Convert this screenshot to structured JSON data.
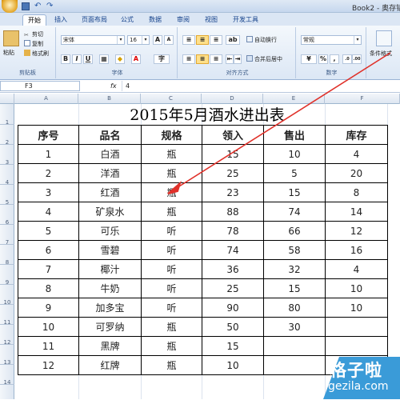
{
  "window": {
    "title": "Book2 - 奥存错"
  },
  "tabs": [
    "开始",
    "插入",
    "页面布局",
    "公式",
    "数据",
    "审阅",
    "视图",
    "开发工具"
  ],
  "ribbon": {
    "paste": "粘贴",
    "cut": "剪切",
    "copy": "复制",
    "format_painter": "格式刷",
    "clipboard_label": "剪贴板",
    "font_name": "宋体",
    "font_size": "16",
    "font_label": "字体",
    "wrap_text": "自动换行",
    "merge_center": "合并后居中",
    "align_label": "对齐方式",
    "number_format": "常规",
    "number_label": "数字",
    "cond_format": "条件格式"
  },
  "formula_bar": {
    "name_box": "F3",
    "fx": "fx",
    "value": "4"
  },
  "columns": [
    "A",
    "B",
    "C",
    "D",
    "E",
    "F"
  ],
  "rows": [
    "1",
    "2",
    "3",
    "4",
    "5",
    "6",
    "7",
    "8",
    "9",
    "10",
    "11",
    "12",
    "13",
    "14"
  ],
  "sheet": {
    "title": "2015年5月酒水进出表",
    "headers": [
      "序号",
      "品名",
      "规格",
      "领入",
      "售出",
      "库存"
    ],
    "data": [
      [
        "1",
        "白酒",
        "瓶",
        "15",
        "10",
        "4"
      ],
      [
        "2",
        "洋酒",
        "瓶",
        "25",
        "5",
        "20"
      ],
      [
        "3",
        "红酒",
        "瓶",
        "23",
        "15",
        "8"
      ],
      [
        "4",
        "矿泉水",
        "瓶",
        "88",
        "74",
        "14"
      ],
      [
        "5",
        "可乐",
        "听",
        "78",
        "66",
        "12"
      ],
      [
        "6",
        "雪碧",
        "听",
        "74",
        "58",
        "16"
      ],
      [
        "7",
        "椰汁",
        "听",
        "36",
        "32",
        "4"
      ],
      [
        "8",
        "牛奶",
        "听",
        "25",
        "15",
        "10"
      ],
      [
        "9",
        "加多宝",
        "听",
        "90",
        "80",
        "10"
      ],
      [
        "10",
        "可罗纳",
        "瓶",
        "50",
        "30",
        ""
      ],
      [
        "11",
        "黑牌",
        "瓶",
        "15",
        "",
        ""
      ],
      [
        "12",
        "红牌",
        "瓶",
        "10",
        "",
        ""
      ]
    ]
  },
  "watermark": {
    "main": "格子啦",
    "sub": "gezila.com"
  },
  "colors": {
    "accent": "#e0312a",
    "ribbon": "#dce7f5",
    "watermark": "#3a9bd8"
  }
}
